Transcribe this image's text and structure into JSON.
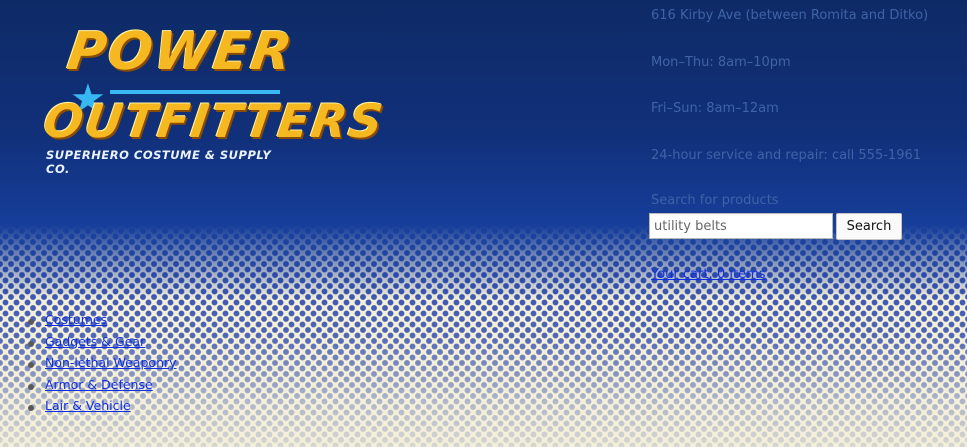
{
  "logo": {
    "line1": "POWER",
    "line2": "OUTFITTERS",
    "tagline": "SUPERHERO COSTUME & SUPPLY CO."
  },
  "info": {
    "address": "616 Kirby Ave (between Romita and Ditko)",
    "hours_weekday": "Mon–Thu: 8am–10pm",
    "hours_weekend": "Fri–Sun: 8am–12am",
    "service": "24-hour service and repair: call 555-1961"
  },
  "search": {
    "label": "Search for products",
    "value": "utility belts",
    "button": "Search"
  },
  "cart": {
    "label": "Your cart: 0 items"
  },
  "nav": {
    "items": [
      {
        "label": "Costumes"
      },
      {
        "label": "Gadgets & Gear"
      },
      {
        "label": "Non-lethal Weaponry"
      },
      {
        "label": "Armor & Defense"
      },
      {
        "label": "Lair & Vehicle"
      }
    ]
  },
  "colors": {
    "navy": "#0e2a66",
    "dot_blue": "#2846af",
    "link": "#1030e0",
    "logo_yellow": "#f5b820",
    "logo_star": "#38b8f2",
    "cream": "#f4efd9"
  }
}
